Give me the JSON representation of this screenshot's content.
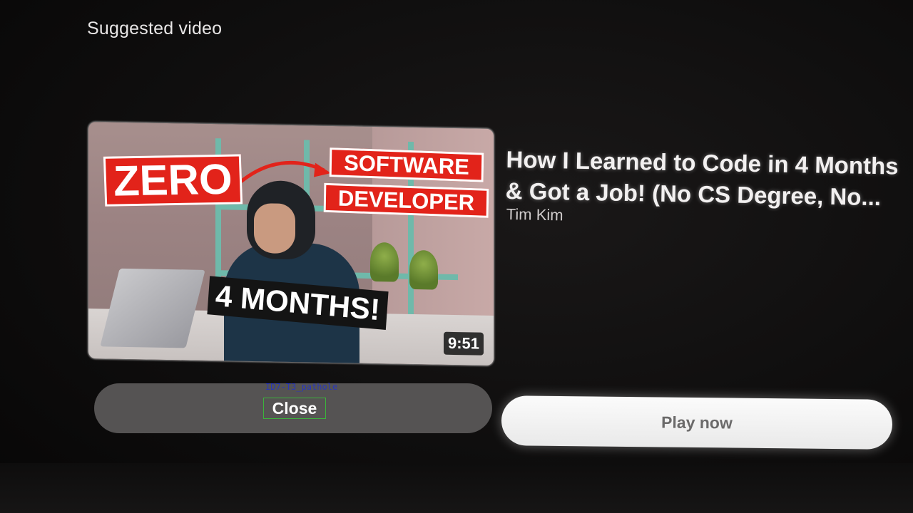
{
  "header": {
    "section_title": "Suggested video"
  },
  "video": {
    "title_line1": "How I Learned to Code in 4 Months",
    "title_line2": "& Got a Job! (No CS Degree, No...",
    "channel": "Tim Kim",
    "duration": "9:51",
    "thumbnail": {
      "label_zero": "ZERO",
      "label_software": "SOFTWARE",
      "label_developer": "DEVELOPER",
      "label_months": "4 MONTHS!"
    }
  },
  "actions": {
    "close_label": "Close",
    "play_label": "Play now"
  },
  "overlay": {
    "tag": "ID7-T3_pathole"
  },
  "colors": {
    "accent_red": "#e2231a",
    "shelf_teal": "#6fb9aa",
    "close_button_bg": "#555353",
    "play_button_bg": "#f5f5f5"
  }
}
